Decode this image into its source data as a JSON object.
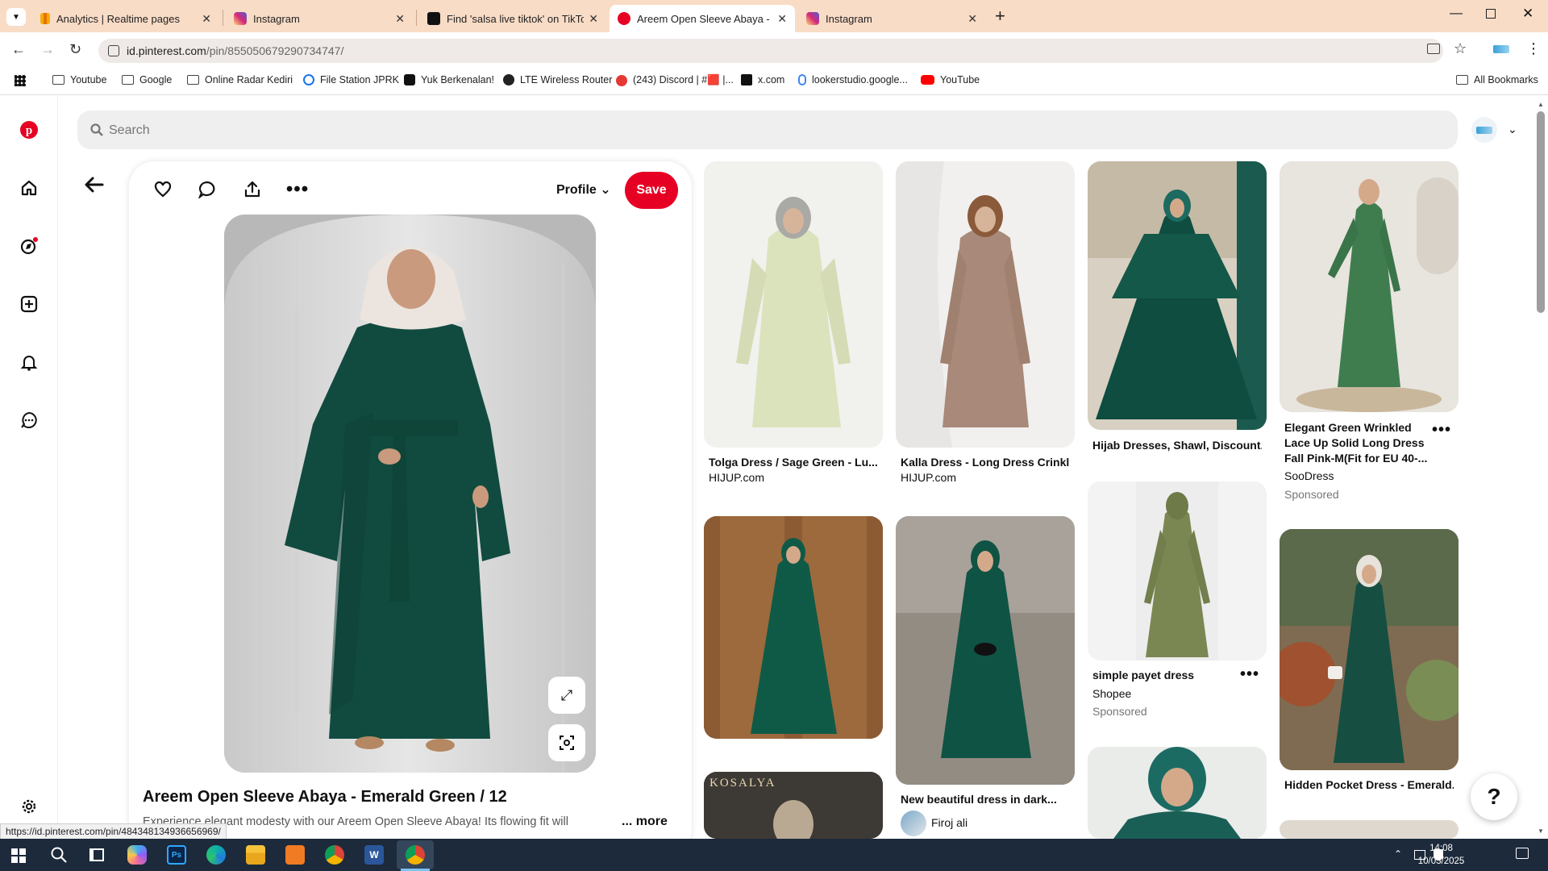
{
  "browser": {
    "tabs": [
      {
        "title": "Analytics | Realtime pages",
        "icon": "analytics-icon",
        "color": "#f9ab00"
      },
      {
        "title": "Instagram",
        "icon": "instagram-icon",
        "color": "#d6249f"
      },
      {
        "title": "Find 'salsa live tiktok' on TikTok",
        "icon": "tiktok-icon",
        "color": "#111111"
      },
      {
        "title": "Areem Open Sleeve Abaya - Em",
        "icon": "pinterest-icon",
        "color": "#e60023"
      },
      {
        "title": "Instagram",
        "icon": "instagram-icon",
        "color": "#d6249f"
      }
    ],
    "url_domain": "id.pinterest.com",
    "url_path": "/pin/855050679290734747/",
    "bookmarks": [
      {
        "label": "Youtube",
        "icon": "folder-icon"
      },
      {
        "label": "Google",
        "icon": "folder-icon"
      },
      {
        "label": "Online Radar Kediri",
        "icon": "folder-icon"
      },
      {
        "label": "File Station JPRK",
        "icon": "file-station-icon"
      },
      {
        "label": "Yuk Berkenalan!",
        "icon": "tiktok-icon"
      },
      {
        "label": "LTE Wireless Router",
        "icon": "globe-icon"
      },
      {
        "label": "(243) Discord | #🟥 |...",
        "icon": "discord-icon"
      },
      {
        "label": "x.com",
        "icon": "x-icon"
      },
      {
        "label": "lookerstudio.google...",
        "icon": "looker-icon"
      },
      {
        "label": "YouTube",
        "icon": "youtube-icon"
      }
    ],
    "all_bookmarks": "All Bookmarks",
    "status_url": "https://id.pinterest.com/pin/484348134936656969/"
  },
  "pinterest": {
    "search_placeholder": "Search",
    "profile_label": "Profile",
    "save_label": "Save",
    "pin_title": "Areem Open Sleeve Abaya - Emerald Green / 12",
    "pin_description": "Experience elegant modesty with our Areem Open Sleeve Abaya! Its flowing fit will",
    "more_label": "... more",
    "help_label": "?",
    "brand_color": "#e60023",
    "grid": [
      {
        "title": "Tolga Dress / Sage Green - Lu...",
        "source": "HIJUP.com"
      },
      {
        "title": "Kalla Dress - Long Dress Crinkl...",
        "source": "HIJUP.com"
      },
      {
        "title": "Hijab Dresses, Shawl, Discount..."
      },
      {
        "title": "Elegant Green Wrinkled Lace Up Solid Long Dress Fall Pink-M(Fit for EU 40-...",
        "source": "SooDress",
        "sponsored": "Sponsored"
      },
      {
        "title": "simple payet dress",
        "source": "Shopee",
        "sponsored": "Sponsored"
      },
      {
        "title": "New beautiful dress in dark...",
        "source": "Firoj ali"
      },
      {
        "title": "Hidden Pocket Dress - Emerald..."
      },
      {
        "banner_text": "KOSALYA"
      }
    ]
  },
  "taskbar": {
    "time": "14:08",
    "date": "10/03/2025"
  }
}
